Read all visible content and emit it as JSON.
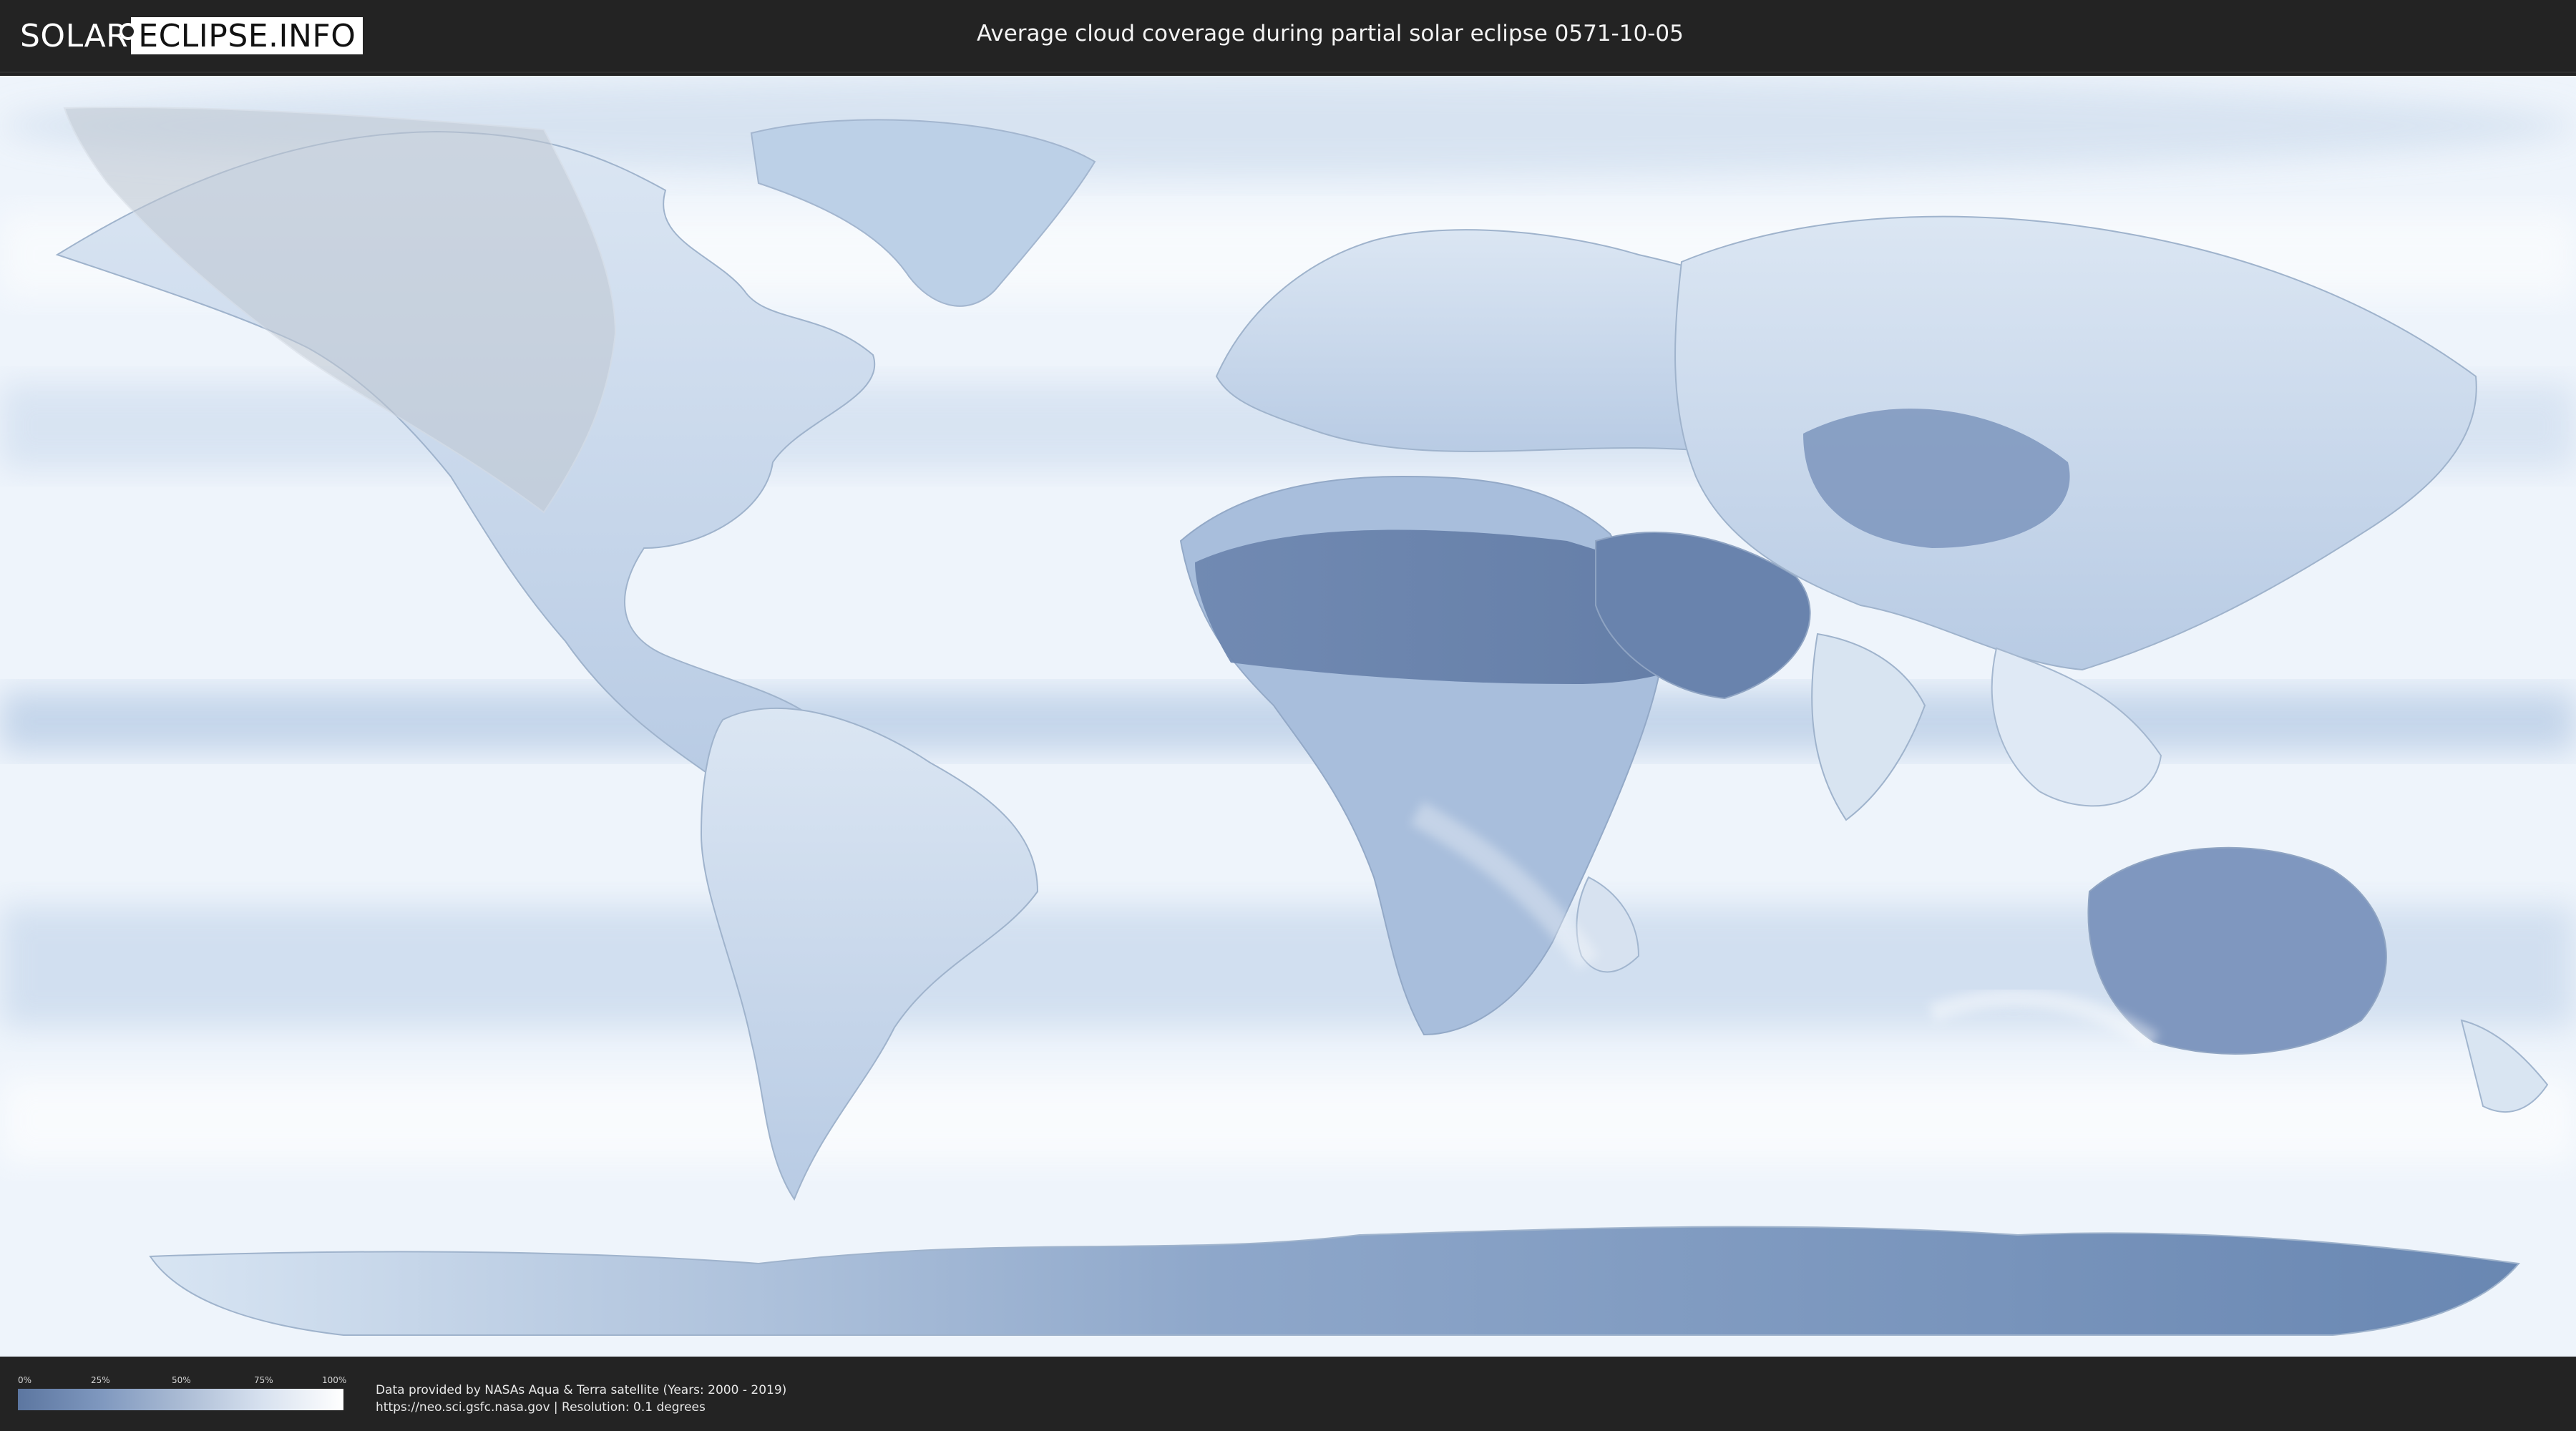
{
  "header": {
    "logo_left": "SOLAR",
    "logo_right": "ECLIPSE.INFO",
    "title": "Average cloud coverage during partial solar eclipse 0571-10-05"
  },
  "map": {
    "type": "cloud-coverage-world-map",
    "landmasses": [
      "North America",
      "Greenland",
      "South America",
      "Europe",
      "Africa",
      "Arabia",
      "Asia",
      "India",
      "Southeast Asia",
      "Australia",
      "Antarctica"
    ],
    "colors": {
      "ocean_clear": "#f7fbff",
      "cloud_band": "#c6d7ec",
      "land_dark": "#5c76a0",
      "eclipse_overlay": "#bcc5d2"
    }
  },
  "legend": {
    "ticks": [
      "0%",
      "25%",
      "50%",
      "75%",
      "100%"
    ],
    "colors": {
      "low": "#5c76a0",
      "high": "#ffffff"
    }
  },
  "credits": {
    "line1": "Data provided by NASAs Aqua & Terra satellite (Years: 2000 - 2019)",
    "line2": "https://neo.sci.gsfc.nasa.gov | Resolution: 0.1 degrees"
  }
}
